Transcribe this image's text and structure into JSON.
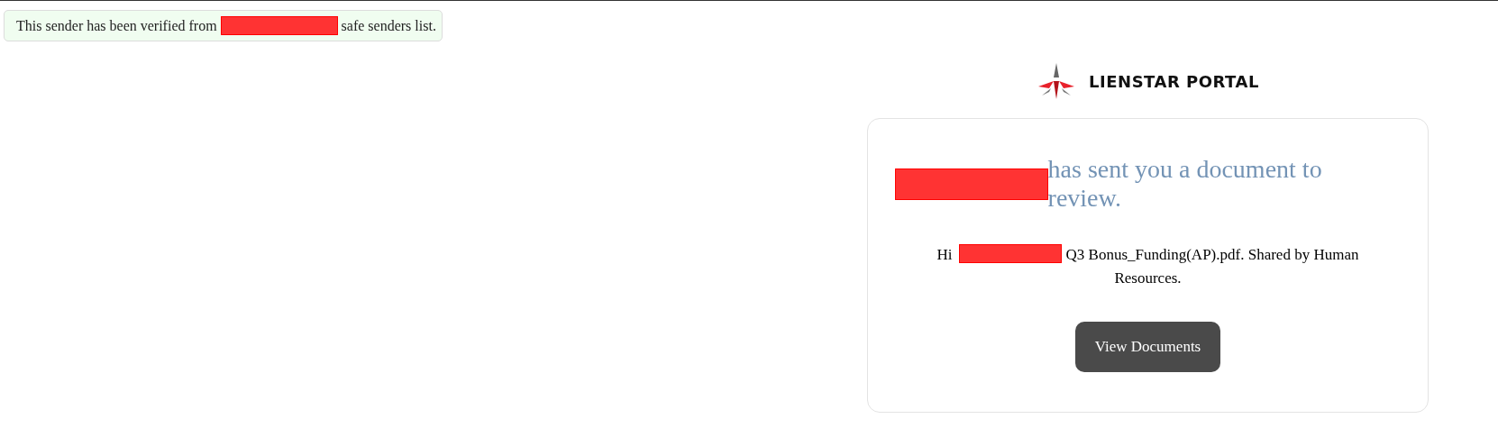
{
  "banner": {
    "parts": [
      {
        "kind": "text",
        "text": "This sender has been verified from"
      },
      {
        "kind": "redaction"
      },
      {
        "kind": "text",
        "text": "safe senders list."
      }
    ]
  },
  "logo": {
    "text": "LIENSTAR PORTAL"
  },
  "card": {
    "heading": [
      {
        "kind": "redaction"
      },
      {
        "kind": "text",
        "text": "has sent you a document to review."
      }
    ],
    "body": [
      {
        "kind": "text",
        "text": "Hi"
      },
      {
        "kind": "redaction"
      },
      {
        "kind": "text",
        "text": "Q3 Bonus_Funding(AP).pdf. Shared by Human Resources."
      }
    ],
    "button": "View Documents"
  }
}
